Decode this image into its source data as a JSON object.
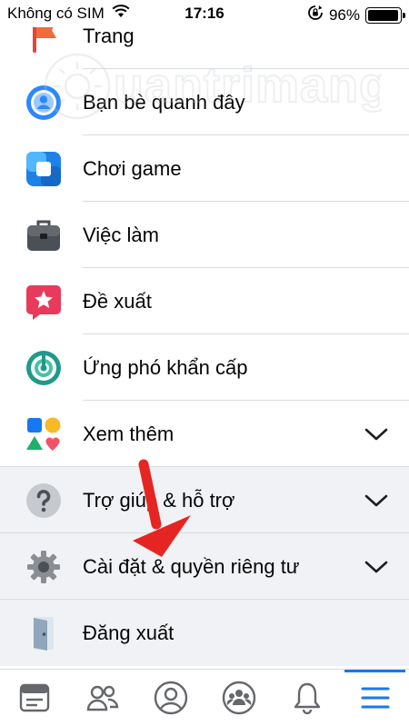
{
  "status_bar": {
    "carrier": "Không có SIM",
    "time": "17:16",
    "battery_percent": "96%",
    "battery_level": 0.96
  },
  "watermark": "Quantrimang",
  "menu": {
    "items": [
      {
        "label": "Trang",
        "icon": "flag-icon"
      },
      {
        "label": "Bạn bè quanh đây",
        "icon": "nearby-friends-icon"
      },
      {
        "label": "Chơi game",
        "icon": "gaming-icon"
      },
      {
        "label": "Việc làm",
        "icon": "briefcase-icon"
      },
      {
        "label": "Đề xuất",
        "icon": "recommendations-icon"
      },
      {
        "label": "Ứng phó khẩn cấp",
        "icon": "crisis-response-icon"
      },
      {
        "label": "Xem thêm",
        "icon": "see-more-icon",
        "expandable": true
      },
      {
        "label": "Trợ giúp & hỗ trợ",
        "icon": "help-icon",
        "expandable": true
      },
      {
        "label": "Cài đặt & quyền riêng tư",
        "icon": "gear-icon",
        "expandable": true
      },
      {
        "label": "Đăng xuất",
        "icon": "door-icon"
      }
    ]
  },
  "tab_bar": {
    "tabs": [
      {
        "name": "news-feed",
        "icon": "news-feed-icon"
      },
      {
        "name": "friends",
        "icon": "friends-icon"
      },
      {
        "name": "profile",
        "icon": "profile-icon"
      },
      {
        "name": "groups",
        "icon": "groups-icon"
      },
      {
        "name": "notifications",
        "icon": "bell-icon"
      },
      {
        "name": "menu",
        "icon": "hamburger-menu-icon",
        "active": true
      }
    ]
  },
  "colors": {
    "accent": "#1877f2",
    "arrow": "#e52521",
    "gray_section": "#f0f2f5"
  }
}
